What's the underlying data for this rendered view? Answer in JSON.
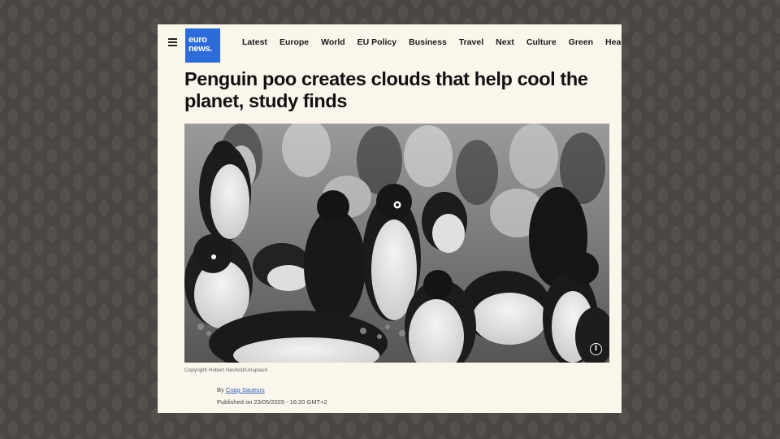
{
  "header": {
    "logo_line1": "euro",
    "logo_line2": "news.",
    "nav": [
      "Latest",
      "Europe",
      "World",
      "EU Policy",
      "Business",
      "Travel",
      "Next",
      "Culture",
      "Green",
      "Health"
    ]
  },
  "article": {
    "headline": "Penguin poo creates clouds that help cool the planet, study finds",
    "photo_caption": "Copyright Hubert Neufeld/Unsplash",
    "by_prefix": "By",
    "author": "Craig Saueurs",
    "published": "Published on 23/05/2025 - 16:20 GMT+2"
  },
  "icons": {
    "menu": "hamburger-menu-icon",
    "info": "info-icon"
  },
  "colors": {
    "brand": "#2c6bd8",
    "page_background": "#fbf6ec",
    "backdrop": "#4a4643"
  }
}
